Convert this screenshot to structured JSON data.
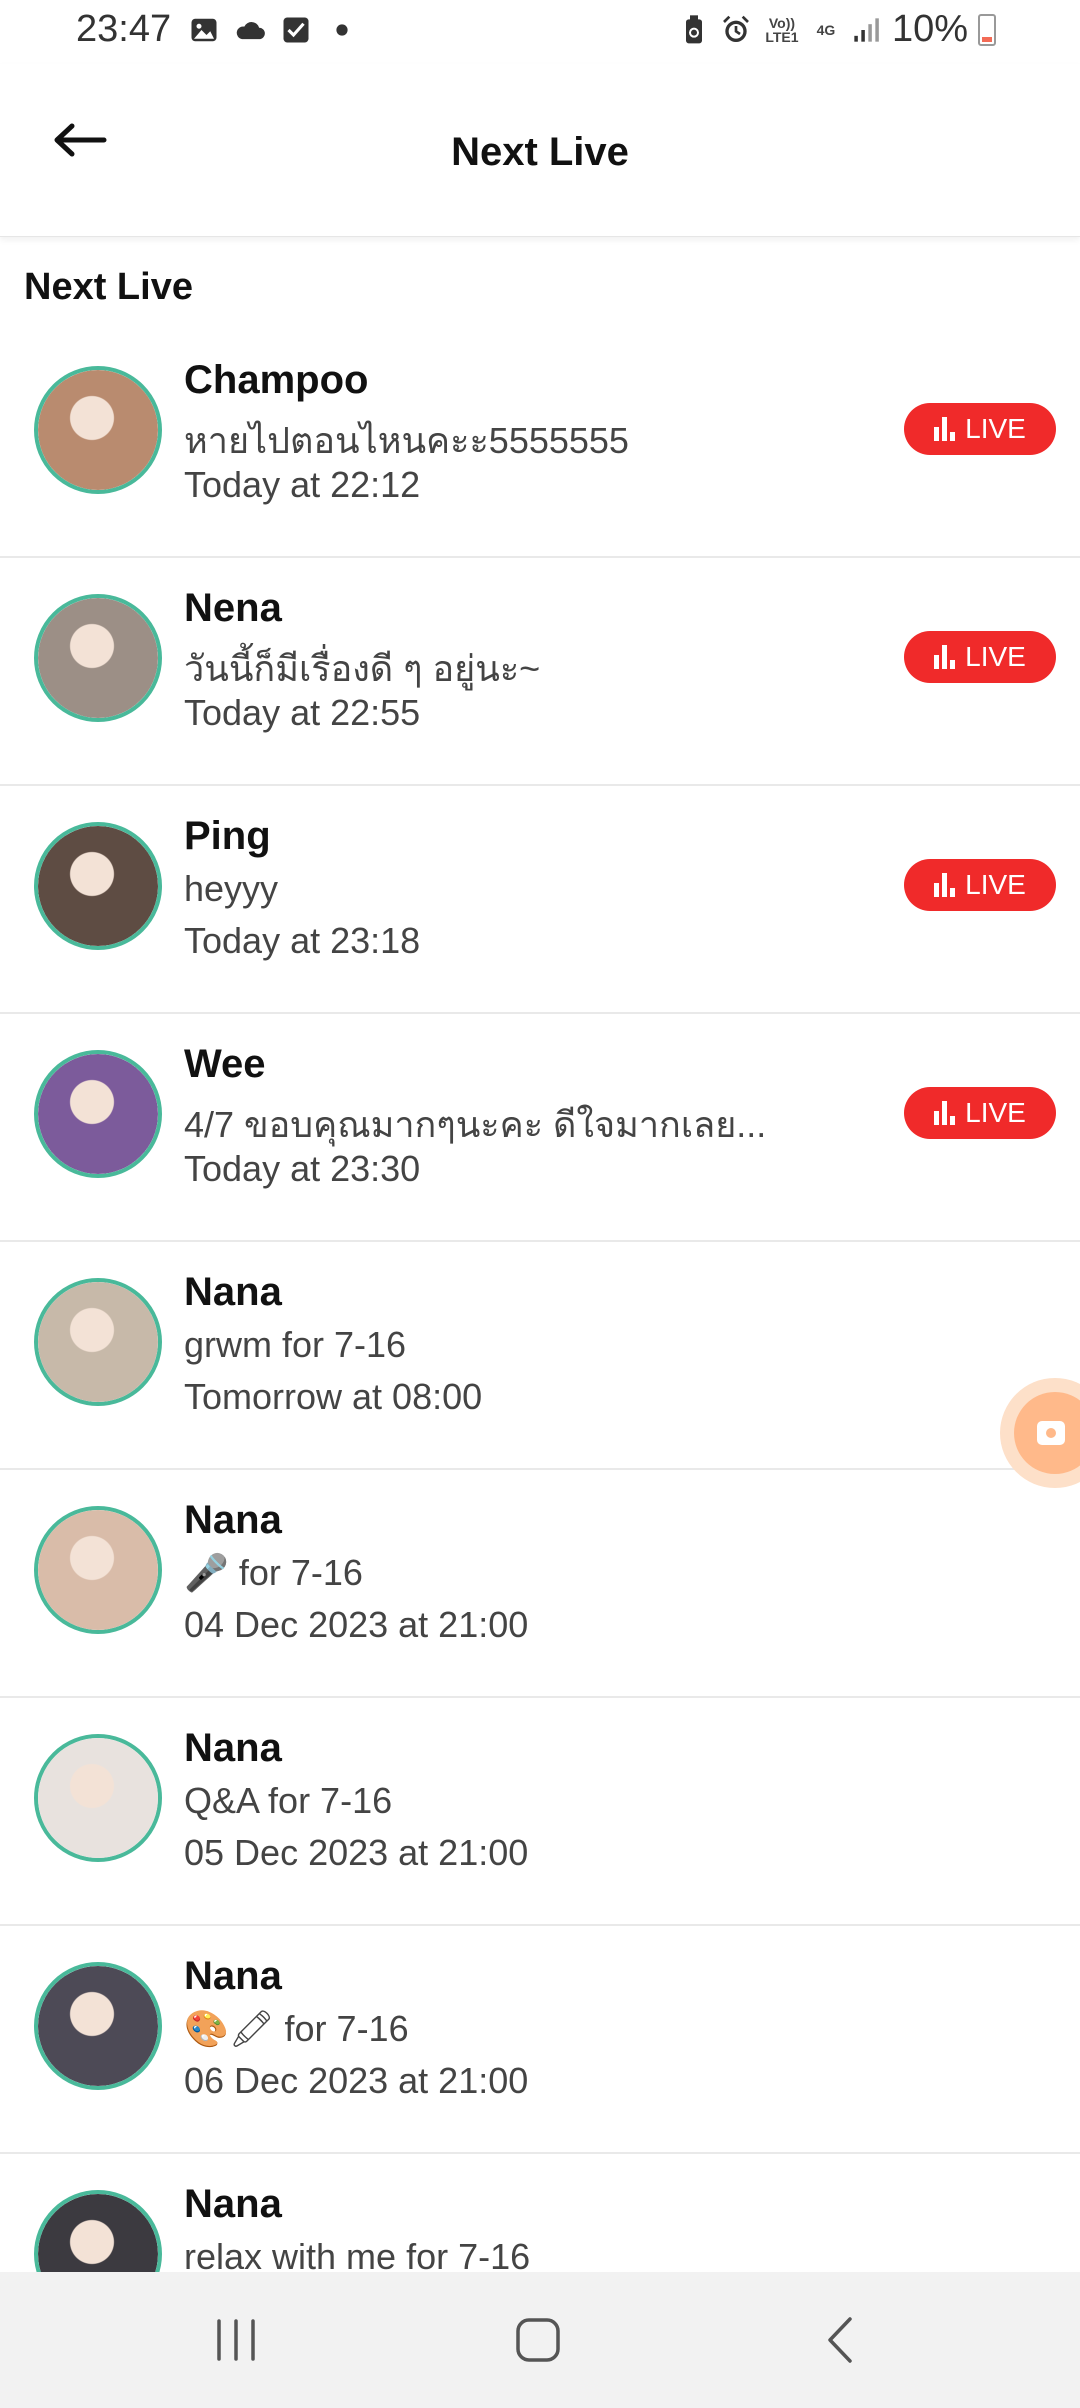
{
  "status_bar": {
    "time": "23:47",
    "battery": "10%",
    "left_icons": [
      "image-icon",
      "cloud-icon",
      "checkbox-icon",
      "dot-icon"
    ],
    "right_icons": [
      "battery-saver-icon",
      "alarm-icon",
      "volte-icon",
      "4g-icon",
      "signal-icon",
      "battery-icon"
    ],
    "volte_label": "Vo)) LTE1",
    "network_label": "4G"
  },
  "header": {
    "title": "Next Live",
    "back_icon": "arrow-left-icon"
  },
  "section_title": "Next Live",
  "live_label": "LIVE",
  "items": [
    {
      "name": "Champoo",
      "desc": "หายไปตอนไหนคะะ5555555",
      "time": "Today at 22:12",
      "live": true,
      "avatar_color": "#b98b6f"
    },
    {
      "name": "Nena",
      "desc": "วันนี้ก็มีเรื่องดี ๆ อยู่นะ~",
      "time": "Today at 22:55",
      "live": true,
      "avatar_color": "#9c8f86"
    },
    {
      "name": "Ping",
      "desc": "heyyy",
      "time": "Today at 23:18",
      "live": true,
      "avatar_color": "#5e4c43"
    },
    {
      "name": "Wee",
      "desc": "4/7 ขอบคุณมากๆนะคะ ดีใจมากเลย...",
      "time": "Today at 23:30",
      "live": true,
      "avatar_color": "#7c5b9b"
    },
    {
      "name": "Nana",
      "desc": "grwm for 7-16",
      "time": "Tomorrow at 08:00",
      "live": false,
      "avatar_color": "#c7b9a9"
    },
    {
      "name": "Nana",
      "desc": "🎤 for 7-16",
      "time": "04 Dec 2023 at 21:00",
      "live": false,
      "avatar_color": "#d9bca9"
    },
    {
      "name": "Nana",
      "desc": "Q&A for 7-16",
      "time": "05 Dec 2023 at 21:00",
      "live": false,
      "avatar_color": "#e8e2de"
    },
    {
      "name": "Nana",
      "desc": "🎨🖍 for 7-16",
      "time": "06 Dec 2023 at 21:00",
      "live": false,
      "avatar_color": "#4d4a56"
    },
    {
      "name": "Nana",
      "desc": "relax with me for 7-16",
      "time": "",
      "live": false,
      "avatar_color": "#3c3a40"
    }
  ],
  "floating_button_icon": "camera-icon",
  "nav": {
    "recents_icon": "recents-icon",
    "home_icon": "home-icon",
    "back_icon": "back-chevron-icon"
  },
  "colors": {
    "accent_live": "#f02a2a",
    "avatar_ring": "#49b99a"
  }
}
